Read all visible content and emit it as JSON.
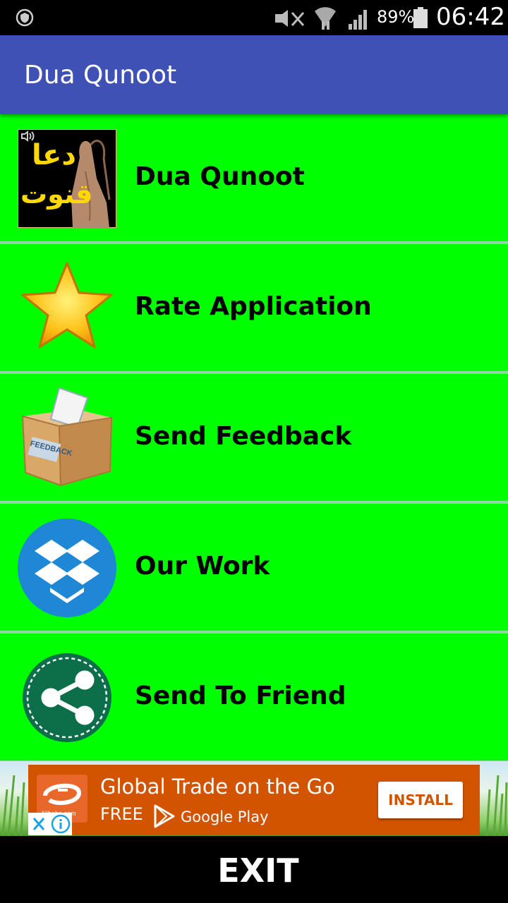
{
  "status_bar": {
    "battery": "89%",
    "time": "06:42"
  },
  "app_bar": {
    "title": "Dua Qunoot"
  },
  "menu": {
    "items": [
      {
        "label": "Dua Qunoot",
        "icon": "dua-qunoot-icon",
        "icon_text_top": "دعا",
        "icon_text_bottom": "قنوت"
      },
      {
        "label": "Rate Application",
        "icon": "star-icon"
      },
      {
        "label": "Send Feedback",
        "icon": "feedback-box-icon",
        "icon_text": "FEEDBACK"
      },
      {
        "label": "Our Work",
        "icon": "dropbox-icon"
      },
      {
        "label": "Send To Friend",
        "icon": "share-icon"
      }
    ]
  },
  "ad": {
    "headline": "Global Trade on the Go",
    "free_label": "FREE",
    "store_label": "Google Play",
    "install_label": "INSTALL",
    "logo_text": "Alibaba.com"
  },
  "footer": {
    "exit_label": "EXIT"
  },
  "colors": {
    "app_bar": "#3f51b5",
    "menu_item_bg": "#00ff00",
    "divider": "#8fd6a4",
    "ad_banner": "#d35400"
  }
}
